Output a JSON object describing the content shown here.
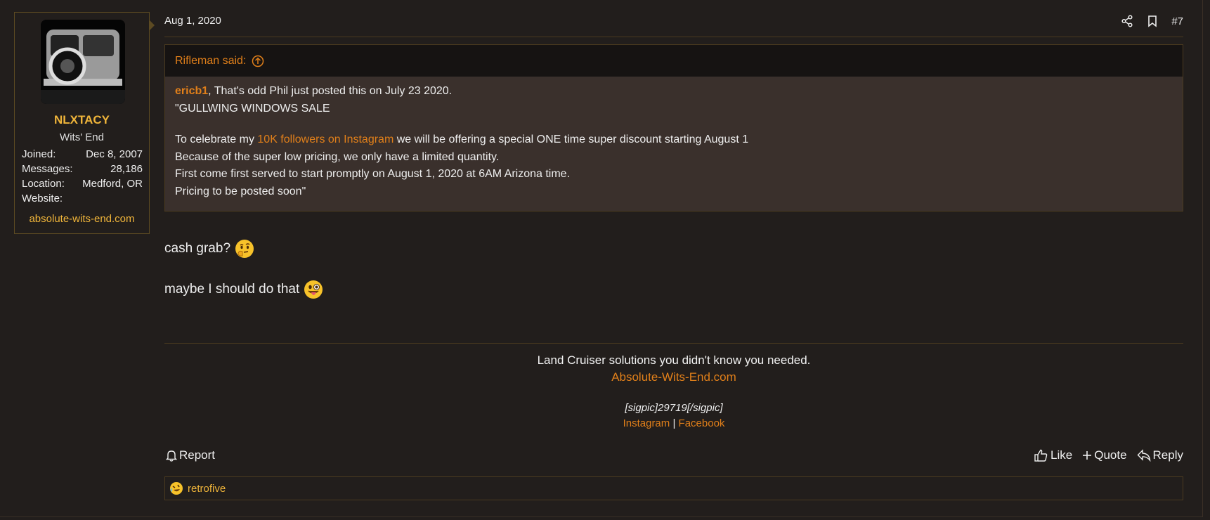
{
  "user": {
    "name": "NLXTACY",
    "title": "Wits' End",
    "joined_label": "Joined:",
    "joined": "Dec 8, 2007",
    "messages_label": "Messages:",
    "messages": "28,186",
    "location_label": "Location:",
    "location": "Medford, OR",
    "website_label": "Website:",
    "website": "absolute-wits-end.com"
  },
  "post": {
    "date": "Aug 1, 2020",
    "number": "#7",
    "icons": [
      "share-icon",
      "bookmark-icon"
    ]
  },
  "quote": {
    "header": "Rifleman said:",
    "author": "ericb1",
    "line1_rest": ", That's odd Phil just posted this on July 23 2020.",
    "line2": "\"GULLWING WINDOWS SALE",
    "line3_pre": "To celebrate my ",
    "line3_link": "10K followers on Instagram",
    "line3_post": " we will be offering a special ONE time super discount starting August 1",
    "line4": "Because of the super low pricing, we only have a limited quantity.",
    "line5": "First come first served to start promptly on August 1, 2020 at 6AM Arizona time.",
    "line6": "Pricing to be posted soon\""
  },
  "message": {
    "line1": "cash grab?",
    "line2": "maybe I should do that"
  },
  "signature": {
    "line1": "Land Cruiser solutions you didn't know you needed.",
    "line2": "Absolute-Wits-End.com",
    "sigpic": "[sigpic]29719[/sigpic]",
    "instagram": "Instagram",
    "separator": "|",
    "facebook": "Facebook"
  },
  "actions": {
    "report": "Report",
    "like": "Like",
    "quote": "Quote",
    "reply": "Reply"
  },
  "reactions": {
    "users": "retrofive"
  }
}
